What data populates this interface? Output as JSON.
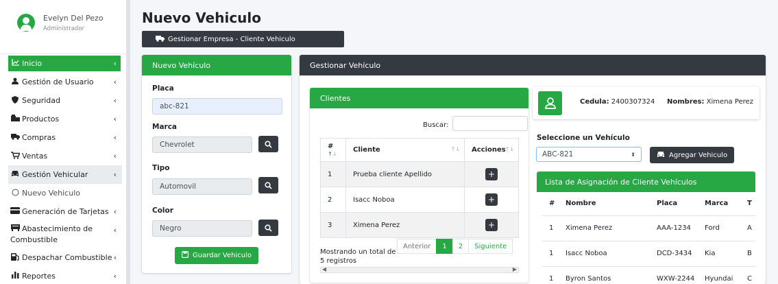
{
  "user": {
    "name": "Evelyn Del Pezo",
    "role": "Administrador"
  },
  "sidebar": {
    "items": [
      {
        "label": "Inicio",
        "icon": "chart-line-icon"
      },
      {
        "label": "Gestión de Usuario",
        "icon": "user-icon"
      },
      {
        "label": "Seguridad",
        "icon": "shield-icon"
      },
      {
        "label": "Productos",
        "icon": "products-icon"
      },
      {
        "label": "Compras",
        "icon": "truck-icon"
      },
      {
        "label": "Ventas",
        "icon": "cart-icon"
      },
      {
        "label": "Gestión Vehicular",
        "icon": "car-icon"
      },
      {
        "label": "Nuevo Vehiculo",
        "icon": "circle-icon"
      },
      {
        "label": "Generación de Tarjetas",
        "icon": "card-icon"
      },
      {
        "label": "Abastecimiento de Combustible",
        "icon": "fuel-icon"
      },
      {
        "label": "Despachar Combustible",
        "icon": "dispatch-icon"
      },
      {
        "label": "Reportes",
        "icon": "bar-chart-icon"
      }
    ]
  },
  "page": {
    "title": "Nuevo Vehiculo",
    "manage_button": "Gestionar Empresa - Cliente Vehiculo"
  },
  "form": {
    "header": "Nuevo Vehículo",
    "placa_label": "Placa",
    "placa_value": "abc-821",
    "marca_label": "Marca",
    "marca_value": "Chevrolet",
    "tipo_label": "Tipo",
    "tipo_value": "Automovil",
    "color_label": "Color",
    "color_value": "Negro",
    "save_button": "Guardar Vehiculo"
  },
  "manage": {
    "header": "Gestionar Vehículo",
    "clients": {
      "header": "Clientes",
      "search_label": "Buscar:",
      "columns": [
        "#",
        "Cliente",
        "Acciones"
      ],
      "rows": [
        {
          "n": "1",
          "cliente": "Prueba cliente Apellido"
        },
        {
          "n": "2",
          "cliente": "Isacc Noboa"
        },
        {
          "n": "3",
          "cliente": "Ximena Perez"
        }
      ],
      "info": "Mostrando un total de 5 registros",
      "pager": {
        "prev": "Anterior",
        "p1": "1",
        "p2": "2",
        "next": "Siguiente"
      }
    },
    "selected_client": {
      "cedula_label": "Cedula:",
      "cedula_value": "2400307324",
      "nombres_label": "Nombres:",
      "nombres_value": "Ximena Perez"
    },
    "vehicle_select": {
      "label": "Seleccione un Vehículo",
      "value": "ABC-821",
      "add_button": "Agregar Vehiculo"
    },
    "assignments": {
      "header": "Lista de Asignación de Cliente Vehículos",
      "columns": [
        "#",
        "Nombre",
        "Placa",
        "Marca",
        "T"
      ],
      "rows": [
        {
          "n": "1",
          "nombre": "Ximena Perez",
          "placa": "AAA-1234",
          "marca": "Ford",
          "t": "A"
        },
        {
          "n": "1",
          "nombre": "Isacc Noboa",
          "placa": "DCD-3434",
          "marca": "Kia",
          "t": "B"
        },
        {
          "n": "1",
          "nombre": "Byron Santos",
          "placa": "WXW-2244",
          "marca": "Hyundai",
          "t": "C"
        }
      ]
    }
  },
  "colors": {
    "accent": "#28a745",
    "dark": "#343a40"
  }
}
